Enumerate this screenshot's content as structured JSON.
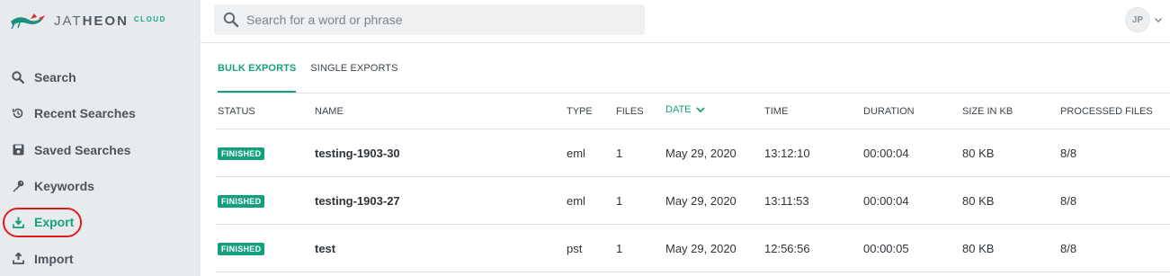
{
  "brand": {
    "name_light": "JAT",
    "name_bold": "HEON",
    "suffix": "CLOUD",
    "colors": {
      "accent": "#14a07f",
      "dragon_red": "#e0302a",
      "dragon_teal": "#1c8f83"
    }
  },
  "sidebar": {
    "items": [
      {
        "label": "Search",
        "icon": "search-icon"
      },
      {
        "label": "Recent Searches",
        "icon": "history-icon"
      },
      {
        "label": "Saved Searches",
        "icon": "save-icon"
      },
      {
        "label": "Keywords",
        "icon": "key-icon"
      },
      {
        "label": "Export",
        "icon": "download-icon",
        "active": true
      },
      {
        "label": "Import",
        "icon": "upload-icon"
      }
    ]
  },
  "search": {
    "placeholder": "Search for a word or phrase",
    "value": ""
  },
  "user": {
    "initials": "JP"
  },
  "tabs": [
    {
      "label": "BULK EXPORTS",
      "active": true
    },
    {
      "label": "SINGLE EXPORTS",
      "active": false
    }
  ],
  "table": {
    "columns": [
      "STATUS",
      "NAME",
      "TYPE",
      "FILES",
      "DATE",
      "TIME",
      "DURATION",
      "SIZE IN KB",
      "PROCESSED FILES"
    ],
    "sorted_column": "DATE",
    "rows": [
      {
        "status": "FINISHED",
        "name": "testing-1903-30",
        "type": "eml",
        "files": "1",
        "date": "May 29, 2020",
        "time": "13:12:10",
        "duration": "00:00:04",
        "size": "80 KB",
        "processed": "8/8"
      },
      {
        "status": "FINISHED",
        "name": "testing-1903-27",
        "type": "eml",
        "files": "1",
        "date": "May 29, 2020",
        "time": "13:11:53",
        "duration": "00:00:04",
        "size": "80 KB",
        "processed": "8/8"
      },
      {
        "status": "FINISHED",
        "name": "test",
        "type": "pst",
        "files": "1",
        "date": "May 29, 2020",
        "time": "12:56:56",
        "duration": "00:00:05",
        "size": "80 KB",
        "processed": "8/8"
      }
    ]
  }
}
